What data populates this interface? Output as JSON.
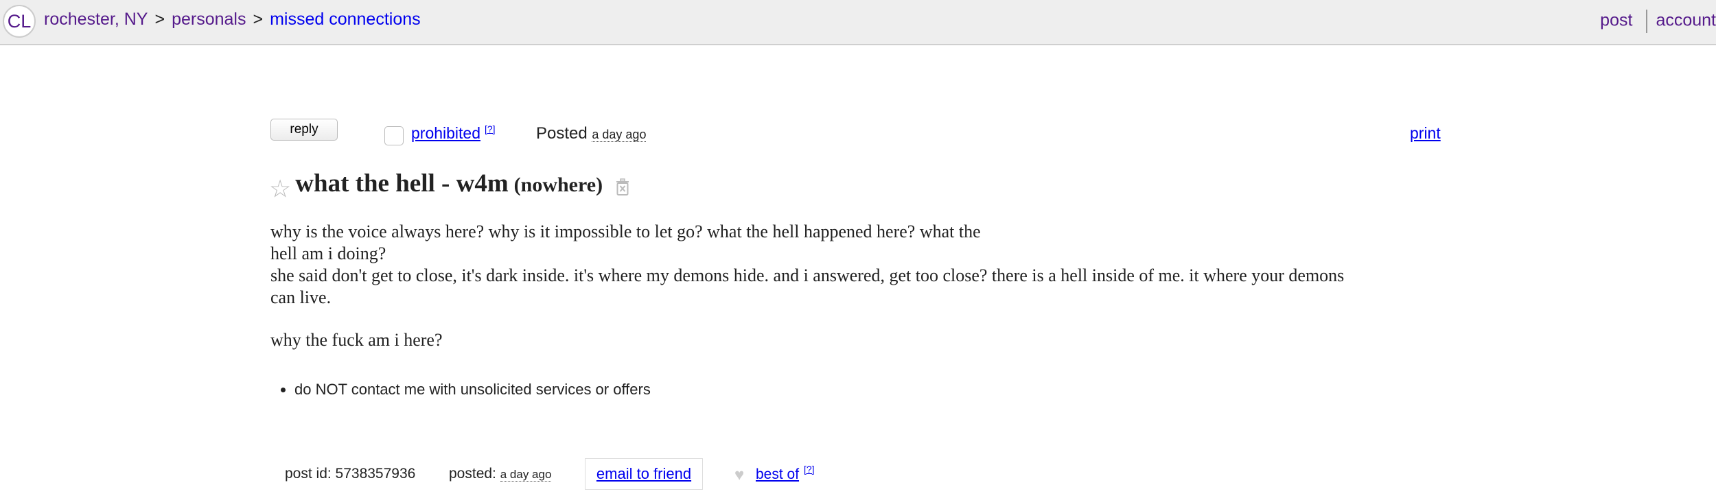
{
  "header": {
    "logo": "CL",
    "breadcrumbs": [
      "rochester, NY",
      "personals",
      "missed connections"
    ],
    "separator": ">",
    "post_label": "post",
    "account_label": "account"
  },
  "postingbar": {
    "reply_label": "reply",
    "prohibited_label": "prohibited",
    "help_label": "[?]",
    "posted_label": "Posted",
    "posted_time": "a day ago",
    "print_label": "print"
  },
  "posting": {
    "star": "☆",
    "title": "what the hell - w4m",
    "location": "(nowhere)",
    "body_lines": [
      "why is the voice always here? why is it impossible to let go? what the hell happened here? what the",
      "hell am i doing?",
      "she said don't get to close, it's dark inside. it's where my demons hide. and i answered, get too close? there is a hell inside of me. it where your demons",
      "can live."
    ],
    "body_last": "why the fuck am i here?",
    "notices": [
      "do NOT contact me with unsolicited services or offers"
    ]
  },
  "footer": {
    "post_id": "post id: 5738357936",
    "posted_label": "posted:",
    "posted_time": "a day ago",
    "email_label": "email to friend",
    "heart": "♥",
    "bestof_label": "best of",
    "help_label": "[?]"
  }
}
